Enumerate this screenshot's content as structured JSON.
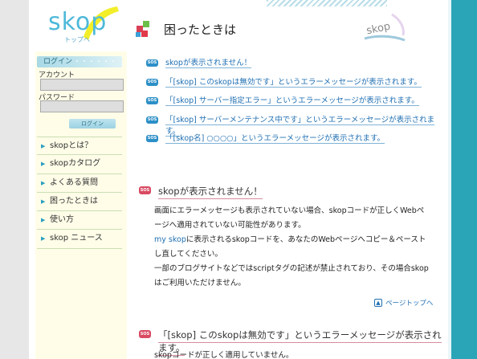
{
  "logo": {
    "text": "skop",
    "sub": "トップへ"
  },
  "page_title": "困ったときは",
  "brand_mark": "skop",
  "sidebar": {
    "login_label": "ログイン",
    "login_dots": "・・・・・・",
    "account_label": "アカウント",
    "password_label": "パスワード",
    "account_value": "",
    "password_value": "",
    "login_button": "ログイン",
    "nav": [
      {
        "label": "skopとは？"
      },
      {
        "label": "skopカタログ"
      },
      {
        "label": "よくある質問"
      },
      {
        "label": "困ったときは"
      },
      {
        "label": "使い方"
      },
      {
        "label": "skop ニュース"
      }
    ]
  },
  "sos_badge": "SOS",
  "toc": [
    "skopが表示されません！",
    "「[skop] このskopは無効です」というエラーメッセージが表示されます。",
    "「[skop] サーバー指定エラー」というエラーメッセージが表示されます。",
    "「[skop] サーバーメンテナンス中です」というエラーメッセージが表示されます。",
    "「[skop名] ○○○○」というエラーメッセージが表示されます。"
  ],
  "section1": {
    "title": "skopが表示されません！",
    "p1": "画面にエラーメッセージも表示されていない場合、skopコードが正しくWebページへ適用されていない可能性があります。",
    "p2_link": "my skop",
    "p2_rest": "に表示されるskopコードを、あなたのWebページへコピー＆ペーストし直してください。",
    "p3": "一部のブログサイトなどではscriptタグの記述が禁止されており、その場合skopはご利用いただけません。",
    "pagetop": "ページトップへ"
  },
  "section2": {
    "title": "「[skop] このskopは無効です」というエラーメッセージが表示されます。",
    "p1": "skopコードが正しく適用していません。"
  },
  "colors": {
    "accent_teal": "#2aa5b8",
    "link_blue": "#1f6fb3",
    "sos_red": "#d94a63",
    "sidebar_bg": "#fffde8"
  }
}
